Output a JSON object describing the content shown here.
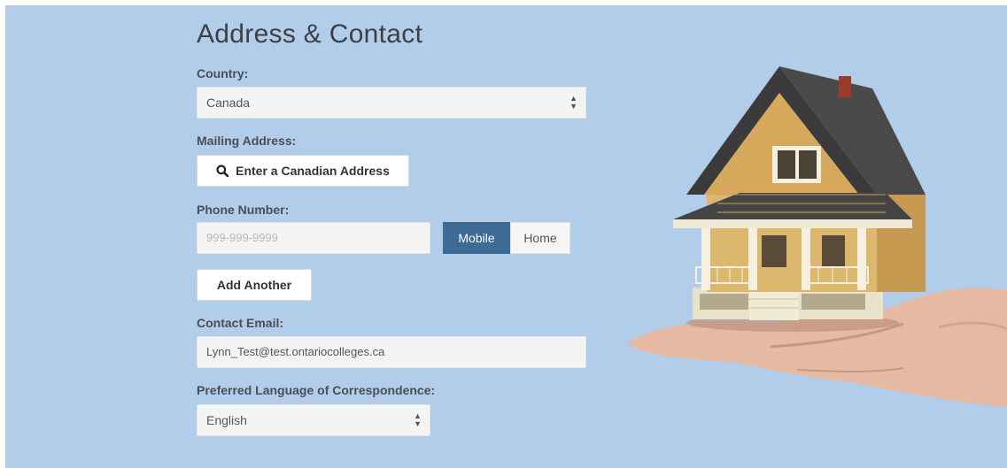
{
  "section": {
    "title": "Address & Contact"
  },
  "country": {
    "label": "Country:",
    "value": "Canada"
  },
  "mailing": {
    "label": "Mailing Address:",
    "button_label": "Enter a Canadian Address",
    "button_icon": "search-icon"
  },
  "phone": {
    "label": "Phone Number:",
    "placeholder": "999-999-9999",
    "types": [
      {
        "label": "Mobile",
        "selected": true
      },
      {
        "label": "Home",
        "selected": false
      }
    ],
    "add_label": "Add Another"
  },
  "email": {
    "label": "Contact Email:",
    "value": "Lynn_Test@test.ontariocolleges.ca"
  },
  "language": {
    "label": "Preferred Language of Correspondence:",
    "value": "English"
  },
  "colors": {
    "background": "#b1cde9",
    "accent": "#3e6a96"
  },
  "illustration": "house-on-hand-image"
}
